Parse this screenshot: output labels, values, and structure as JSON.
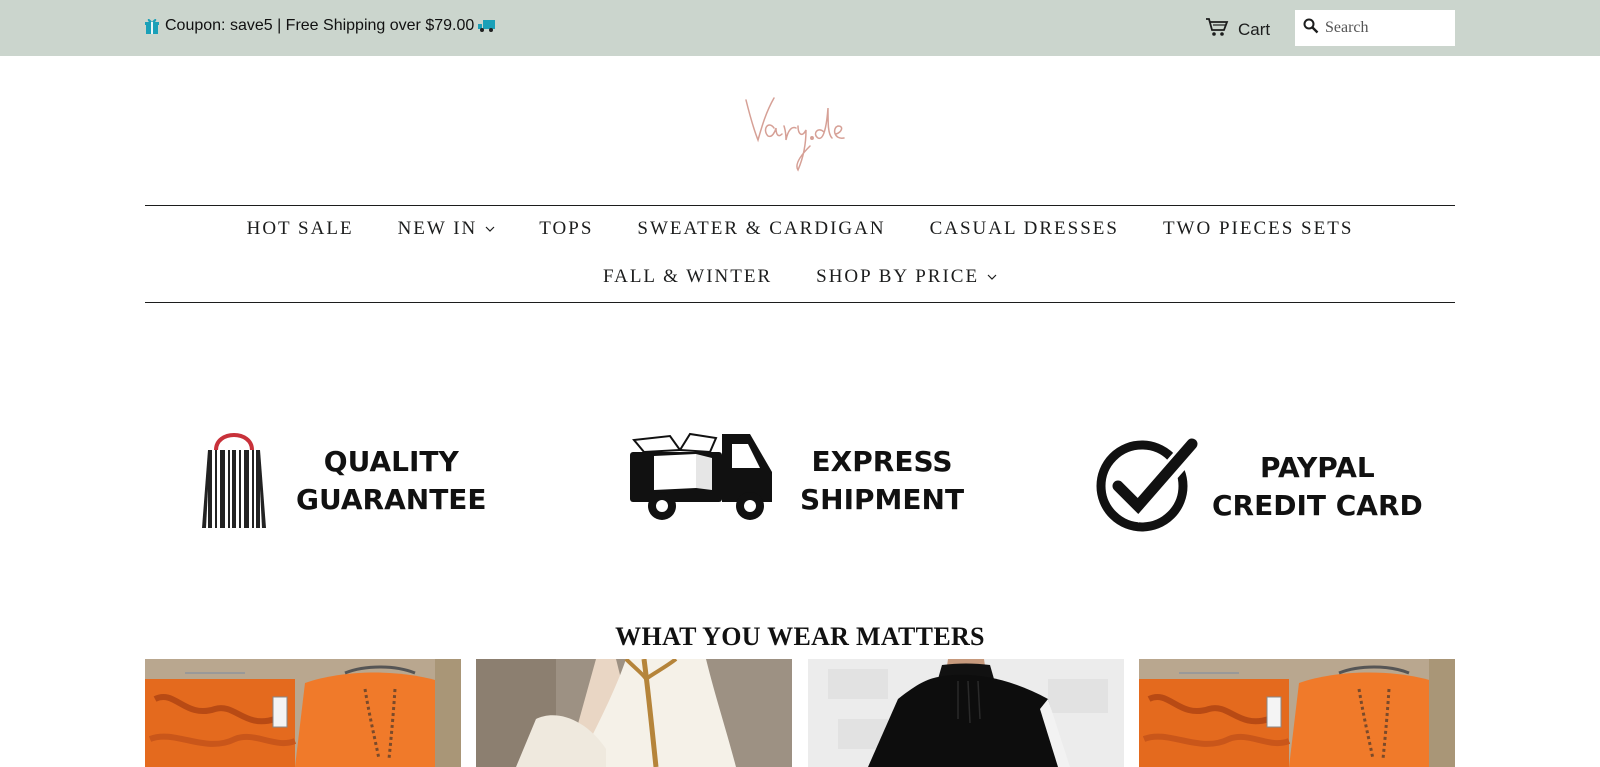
{
  "announcement": {
    "text": "Coupon: save5 | Free Shipping over $79.00"
  },
  "header": {
    "cart_label": "Cart",
    "search_placeholder": "Search"
  },
  "brand": {
    "logo_text": "Varyde",
    "logo_color": "#d6a096"
  },
  "nav": {
    "row1": [
      {
        "label": "HOT SALE",
        "has_dropdown": false
      },
      {
        "label": "NEW IN",
        "has_dropdown": true
      },
      {
        "label": "TOPS",
        "has_dropdown": false
      },
      {
        "label": "SWEATER & CARDIGAN",
        "has_dropdown": false
      },
      {
        "label": "CASUAL DRESSES",
        "has_dropdown": false
      },
      {
        "label": "TWO PIECES SETS",
        "has_dropdown": false
      }
    ],
    "row2": [
      {
        "label": "FALL & WINTER",
        "has_dropdown": false
      },
      {
        "label": "SHOP BY PRICE",
        "has_dropdown": true
      }
    ]
  },
  "features": [
    {
      "line1": "QUALITY",
      "line2": "GUARANTEE",
      "icon": "shopping-bag-barcode-icon"
    },
    {
      "line1": "EXPRESS",
      "line2": "SHIPMENT",
      "icon": "delivery-truck-icon"
    },
    {
      "line1": "PAYPAL",
      "line2": "CREDIT CARD",
      "icon": "checkmark-circle-icon"
    }
  ],
  "section": {
    "title": "WHAT YOU WEAR MATTERS"
  },
  "products": [
    {
      "image": "orange-camo-set-image"
    },
    {
      "image": "white-zip-sweater-image"
    },
    {
      "image": "black-blouse-image"
    },
    {
      "image": "orange-camo-set-image"
    }
  ],
  "colors": {
    "announcement_bg": "#cbd5cd",
    "text": "#1c1d1d",
    "bag_handle": "#c8313a",
    "icon_teal": "#1aa0b8"
  }
}
